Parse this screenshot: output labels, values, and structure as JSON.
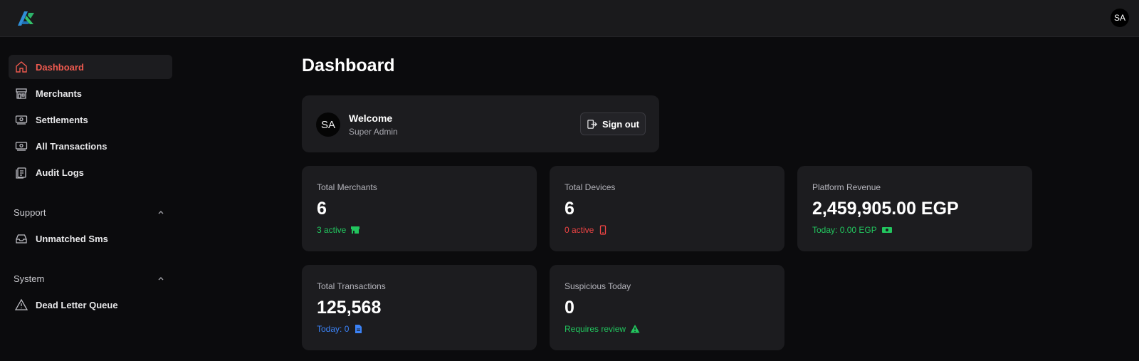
{
  "topbar": {
    "user_initials": "SA"
  },
  "sidebar": {
    "items": [
      {
        "label": "Dashboard",
        "icon": "home-icon"
      },
      {
        "label": "Merchants",
        "icon": "store-icon"
      },
      {
        "label": "Settlements",
        "icon": "banknote-icon"
      },
      {
        "label": "All Transactions",
        "icon": "banknote-icon"
      },
      {
        "label": "Audit Logs",
        "icon": "clipboard-icon"
      }
    ],
    "support": {
      "title": "Support",
      "items": [
        {
          "label": "Unmatched Sms",
          "icon": "inbox-icon"
        }
      ]
    },
    "system": {
      "title": "System",
      "items": [
        {
          "label": "Dead Letter Queue",
          "icon": "warning-icon"
        }
      ]
    }
  },
  "main": {
    "title": "Dashboard",
    "welcome": {
      "initials": "SA",
      "title": "Welcome",
      "role": "Super Admin",
      "signout_label": "Sign out"
    },
    "stats": [
      {
        "label": "Total Merchants",
        "value": "6",
        "sub": "3 active",
        "sub_color": "#22c55e",
        "icon": "store-icon"
      },
      {
        "label": "Total Devices",
        "value": "6",
        "sub": "0 active",
        "sub_color": "#ef4444",
        "icon": "phone-icon"
      },
      {
        "label": "Platform Revenue",
        "value": "2,459,905.00 EGP",
        "sub": "Today: 0.00 EGP",
        "sub_color": "#22c55e",
        "icon": "banknote-icon"
      },
      {
        "label": "Total Transactions",
        "value": "125,568",
        "sub": "Today: 0",
        "sub_color": "#3b82f6",
        "icon": "document-icon"
      },
      {
        "label": "Suspicious Today",
        "value": "0",
        "sub": "Requires review",
        "sub_color": "#22c55e",
        "icon": "warning-icon"
      }
    ]
  },
  "colors": {
    "accent": "#ef5a4f",
    "background": "#0b0b0d",
    "card": "#1c1c1f"
  }
}
